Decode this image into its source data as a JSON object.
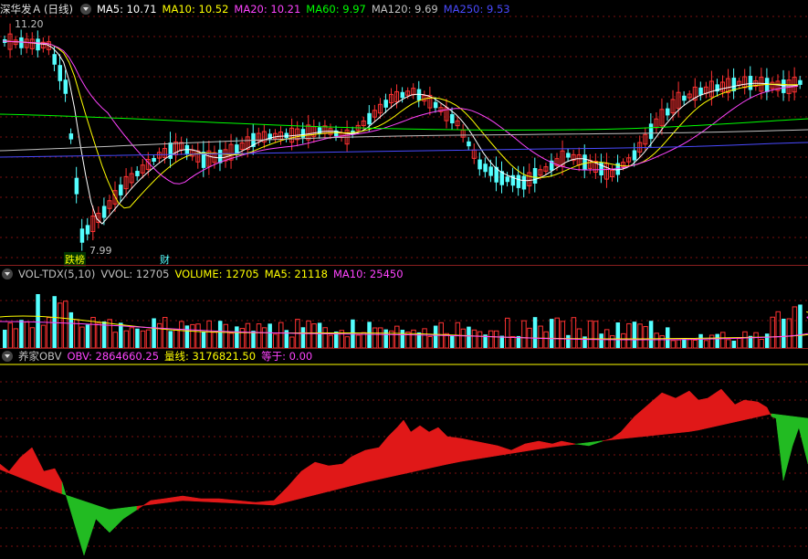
{
  "main": {
    "stock": "深华发Ａ",
    "period": "(日线)",
    "ma": [
      {
        "label": "MA5: 10.71",
        "color": "#ffffff"
      },
      {
        "label": "MA10: 10.52",
        "color": "#ffff00"
      },
      {
        "label": "MA20: 10.21",
        "color": "#ff44ff"
      },
      {
        "label": "MA60: 9.97",
        "color": "#00ff00"
      },
      {
        "label": "MA120: 9.69",
        "color": "#c0c0c0"
      },
      {
        "label": "MA250: 9.53",
        "color": "#4a4aff"
      }
    ],
    "high_label": "11.20",
    "low_label": "7.99",
    "tag1": "跌榜",
    "tag2": "财"
  },
  "volume": {
    "name": "VOL-TDX(5,10)",
    "vvol": "VVOL: 12705",
    "volume": "VOLUME: 12705",
    "ma5": "MA5: 21118",
    "ma10": "MA10: 25450"
  },
  "obv": {
    "name": "养家OBV",
    "obv": "OBV: 2864660.25",
    "line": "量线: 3176821.50",
    "eq": "等于: 0.00"
  },
  "colors": {
    "up": "#ff3232",
    "down": "#54ffff",
    "obv_pos": "#e01818",
    "obv_neg": "#22bb22",
    "grid": "#7a1010"
  }
}
